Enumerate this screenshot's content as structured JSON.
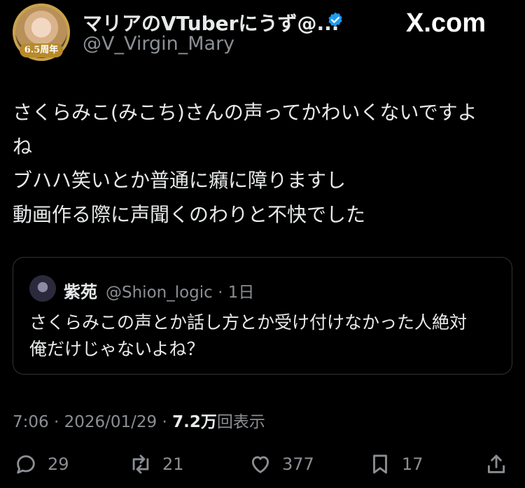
{
  "header": {
    "avatar_badge": "6.5周年",
    "display_name": "マリアのVTuberにうず@...",
    "handle": "@V_Virgin_Mary",
    "site_logo": "X.com",
    "verified_icon": "verified-badge-icon",
    "verified_color": "#1d9bf0"
  },
  "tweet": {
    "lines": [
      "さくらみこ(みこち)さんの声ってかわいくないですよ",
      "ね",
      "ブハハ笑いとか普通に癪に障りますし",
      "動画作る際に声聞くのわりと不快でした"
    ]
  },
  "quote": {
    "name": "紫苑",
    "meta": "@Shion_logic · 1日",
    "lines": [
      "さくらみこの声とか話し方とか受け付けなかった人絶対",
      "俺だけじゃないよね？"
    ]
  },
  "meta": {
    "time_date": "7:06 · 2026/01/29 · ",
    "views_count": "7.2万",
    "views_label": "回表示"
  },
  "actions": {
    "reply": {
      "icon": "reply-icon",
      "count": "29"
    },
    "retweet": {
      "icon": "retweet-icon",
      "count": "21"
    },
    "like": {
      "icon": "heart-icon",
      "count": "377"
    },
    "bookmark": {
      "icon": "bookmark-icon",
      "count": "17"
    },
    "share": {
      "icon": "share-icon"
    }
  }
}
